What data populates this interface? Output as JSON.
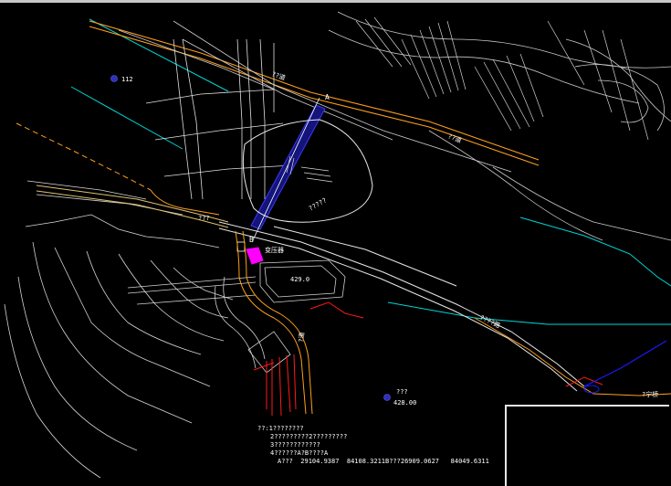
{
  "drawing": {
    "label_A": "A",
    "label_B": "B",
    "road_label_1": "??道",
    "road_label_2": "??道",
    "road_label_3": "????路",
    "road_label_4": "?道",
    "gate_label": "???",
    "station_label": "变压器",
    "elev_bldg": "429.0",
    "marker_1_label": "112",
    "marker_2_label": "???",
    "marker_2_elev": "428.00",
    "hill_label": "?????",
    "river_label": "???",
    "right_label": "?宁桥"
  },
  "notes": {
    "line1": "??:1????????",
    "line2": "2?????????2?????????",
    "line3": "3????????????",
    "line4": "4??????A?B????A",
    "line5": "A???  29104.9387  84108.3211B???26909.0627   84049.6311"
  },
  "colors": {
    "background": "#000000",
    "linework": "#ffffff",
    "road": "#ff9f1a",
    "river": "#00e5e5",
    "red": "#ff1a1a",
    "magenta": "#ff00ff",
    "blue": "#1a1aff"
  }
}
